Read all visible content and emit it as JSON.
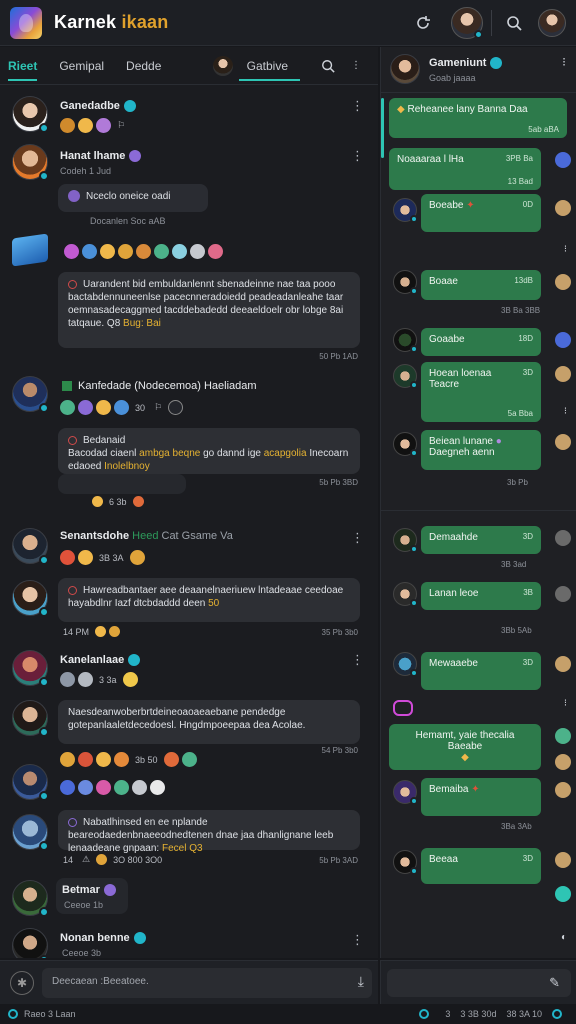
{
  "app": {
    "title_main": "Karnek",
    "title_accent": "ikaan"
  },
  "colors": {
    "accent": "#2ec5b4",
    "bubble_green": "#2d7a4b",
    "badge": "#21b5c9",
    "highlight": "#e5b232"
  },
  "tabs": {
    "t1": "Rieet",
    "t2": "Gemipal",
    "t3": "Dedde",
    "t4": "Gatbive"
  },
  "posts": {
    "p1": {
      "name": "Ganedadbe",
      "time": ""
    },
    "p2": {
      "name": "Hanat lhame",
      "sub": "Codeh 1 Jud"
    },
    "p3": {
      "pill": "Nceclo oneice oadi",
      "pill_sub": "Docanlen Soc aAB"
    },
    "p4": {
      "text": "Uarandent bid embuldanlennt sbenadeinne nae taa pooo bactabdennuneenlse pacecnneradoiedd peadeadanleahe taar oemnasadecaggmed tacddebadedd deeaeldoelr obr lobge 8ai tatqaue. Q8",
      "accent": "Bug: Bai",
      "time": "50 Pb 1AD"
    },
    "p5": {
      "name": "Kanfedade (Nodecemoa) Haeliadam",
      "count": "30",
      "time": "33 Pb"
    },
    "p6": {
      "text1": "Bedanaid",
      "text2": "Bacodad ciaenl",
      "hl1": "ambga beqne",
      "text3": "go dannd ige",
      "hl2": "acapgolia",
      "text4": "Inecoarn edaoed",
      "hl3": "Inolelbnoy",
      "time": "5b Pb 3BD",
      "foot": "6 3b"
    },
    "p7": {
      "name": "Senantsdohe",
      "tag": "Heed",
      "tag2": "Cat Gsame Va",
      "sub": "3B 3A"
    },
    "p8": {
      "text": "Hawreadbantaer aee deaanelnaeriuew lntadeaae ceedoae hayabdlnr Iazf dtcbdaddd deen",
      "hl": "50",
      "time": "14 PM",
      "foot": "35 Pb 3b0"
    },
    "p9": {
      "name": "Kanelanlaae",
      "sub": "3 3a"
    },
    "p10": {
      "text": "Naesdeanwoberbrtdeineoaoaeaebane pendedge gotepanlaaletdecedoesl. Hngdmpoeepaa dea Acolae.",
      "time": "54 Pb 3b0",
      "foot": "3b 50"
    },
    "p11": {
      "text": "Nabatlhinsed en ee nplande beareodaedenbnaeeodnedtenen dnae jaa dhanlignane leeb lenaadeane gnpaan:",
      "hl": "Fecel Q3",
      "time": "5b Pb 3AD",
      "foot": "3O 800 3O0"
    },
    "p12": {
      "name": "Betmar",
      "sub": "Ceeoe 1b"
    },
    "p13": {
      "name": "Nonan benne",
      "sub": "Ceeoe 3b"
    }
  },
  "composer": {
    "placeholder": "Deecaean :Beeatoee."
  },
  "right": {
    "header": {
      "name": "Gameniunt",
      "sub": "Goab jaaaa"
    },
    "msgs": [
      {
        "text": "Reheanee lany Banna Daa",
        "time": "5ab aBA"
      },
      {
        "text": "Noaaaraa l lHa",
        "time": "3PB Ba",
        "time2": "13 Bad"
      },
      {
        "text": "Boeabe",
        "time": "0D"
      },
      {
        "text": "Boaae",
        "time": "13dB"
      },
      {
        "text": "Goaabe",
        "time": "18D"
      },
      {
        "text": "Hoean loenaa",
        "text2": "Teacre",
        "time": "3D",
        "time2": "5a Bba"
      },
      {
        "text": "Beiean lunane",
        "text2": "Daegneh aenn",
        "time": "3b Pb"
      },
      {
        "text": "Demaahde",
        "time": "3D"
      },
      {
        "text": "Lanan leoe",
        "time": "3B"
      },
      {
        "text": "Mewaaebe",
        "time": "3D"
      },
      {
        "text": "Hemamt, yaie thecalia Baeabe",
        "time": ""
      },
      {
        "text": "Bemaiba",
        "time": "3D"
      },
      {
        "text": "Beeaa",
        "time": "3D"
      }
    ],
    "stamps": [
      "3B Ba 3BB",
      "3B 3ad",
      "3Bb 5Ab",
      "3Ba 3Ab",
      "5a Bb"
    ]
  },
  "status": {
    "left": "Raeo 3 Laan",
    "r1": "3",
    "r2": "3 3B 30d",
    "r3": "38 3A 10"
  }
}
